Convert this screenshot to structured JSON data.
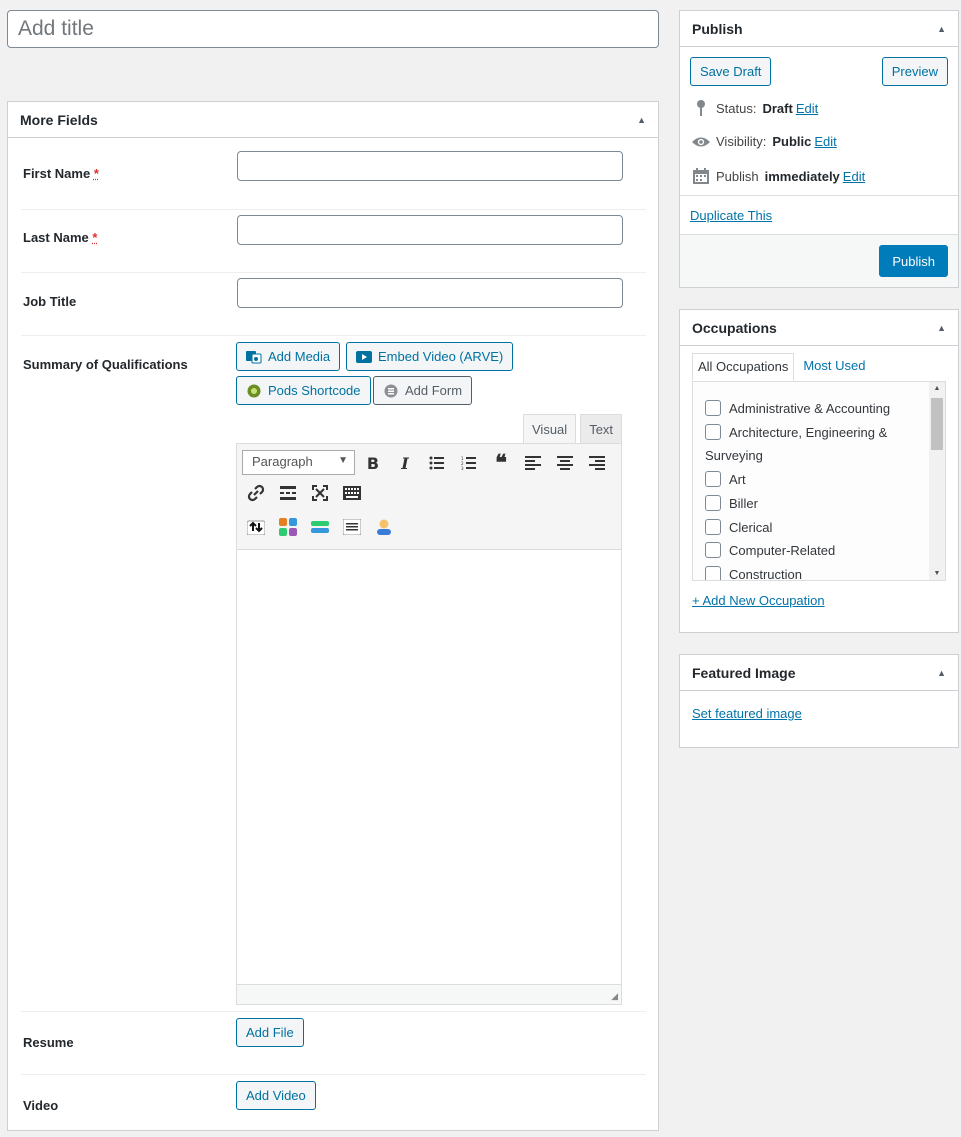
{
  "title_input": {
    "placeholder": "Add title"
  },
  "more_fields": {
    "heading": "More Fields",
    "fields": [
      {
        "label": "First Name",
        "required": "*"
      },
      {
        "label": "Last Name",
        "required": "*"
      },
      {
        "label": "Job Title"
      },
      {
        "label": "Summary of Qualifications"
      },
      {
        "label": "Resume"
      },
      {
        "label": "Video"
      }
    ],
    "media_buttons": [
      "Add Media",
      "Embed Video (ARVE)",
      "Pods Shortcode",
      "Add Form"
    ],
    "editor": {
      "tabs": [
        "Visual",
        "Text"
      ],
      "format_select": "Paragraph",
      "bold": "B",
      "italic": "I"
    },
    "add_file": "Add File",
    "add_video": "Add Video"
  },
  "publish": {
    "heading": "Publish",
    "save_draft": "Save Draft",
    "preview": "Preview",
    "status_label": "Status:",
    "status_value": "Draft",
    "visibility_label": "Visibility:",
    "visibility_value": "Public",
    "publish_label": "Publish",
    "publish_value": "immediately",
    "edit": "Edit",
    "duplicate": "Duplicate This",
    "publish_button": "Publish"
  },
  "occupations": {
    "heading": "Occupations",
    "tabs": [
      "All Occupations",
      "Most Used"
    ],
    "items": [
      "Administrative & Accounting",
      "Architecture, Engineering &",
      "Surveying",
      "Art",
      "Biller",
      "Clerical",
      "Computer-Related",
      "Construction"
    ],
    "add_new": "+ Add New Occupation"
  },
  "featured_image": {
    "heading": "Featured Image",
    "set_link": "Set featured image"
  },
  "colors": {
    "primary": "#007cba",
    "link": "#0073aa",
    "required": "#dc3232"
  }
}
